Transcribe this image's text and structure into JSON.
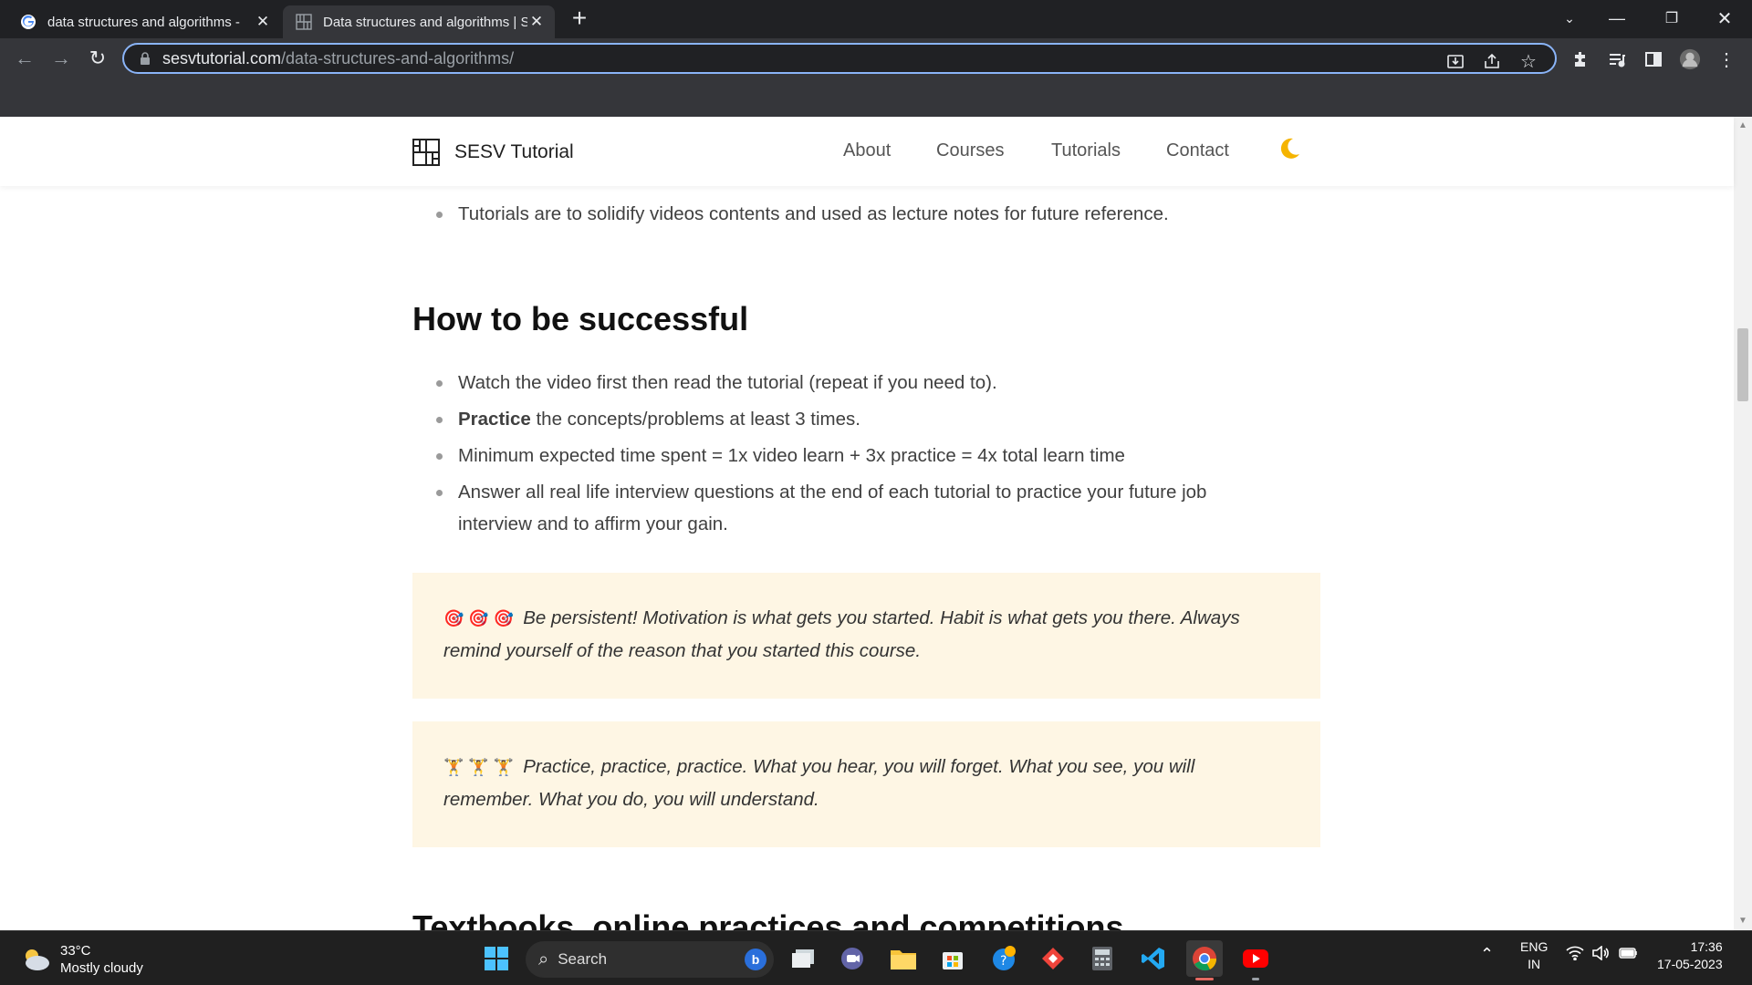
{
  "browser": {
    "tabs": [
      {
        "title": "data structures and algorithms - ",
        "active": false
      },
      {
        "title": "Data structures and algorithms | S",
        "active": true
      }
    ],
    "url_host": "sesvtutorial.com",
    "url_path": "/data-structures-and-algorithms/"
  },
  "site": {
    "brand": "SESV Tutorial",
    "nav": [
      "About",
      "Courses",
      "Tutorials",
      "Contact"
    ]
  },
  "content": {
    "intro_bullet": "Tutorials are to solidify videos contents and used as lecture notes for future reference.",
    "heading": "How to be successful",
    "bullets": [
      {
        "text": "Watch the video first then read the tutorial (repeat if you need to)."
      },
      {
        "bold": "Practice",
        "text": " the concepts/problems at least 3 times."
      },
      {
        "text": "Minimum expected time spent = 1x video learn + 3x practice = 4x total learn time"
      },
      {
        "text": "Answer all real life interview questions at the end of each tutorial to practice your future job interview and to affirm your gain."
      }
    ],
    "callouts": [
      {
        "emoji": "🎯 🎯 🎯",
        "text": "Be persistent! Motivation is what gets you started. Habit is what gets you there. Always remind yourself of the reason that you started this course."
      },
      {
        "emoji": "🏋 🏋 🏋",
        "text": "Practice, practice, practice. What you hear, you will forget. What you see, you will remember. What you do, you will understand."
      }
    ],
    "next_heading_partial": "Textbooks, online practices and competitions"
  },
  "taskbar": {
    "weather_temp": "33°C",
    "weather_desc": "Mostly cloudy",
    "search_label": "Search",
    "lang": "ENG",
    "region": "IN",
    "time": "17:36",
    "date": "17-05-2023"
  },
  "colors": {
    "callout_bg": "#fef6e4",
    "omnibox_border": "#8ab4f8",
    "moon": "#f5b400"
  }
}
